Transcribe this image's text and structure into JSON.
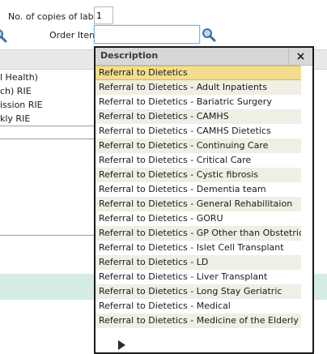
{
  "form": {
    "copies_label": "No. of copies of labels",
    "copies_value": "1",
    "order_item_label": "Order Item",
    "order_item_value": ""
  },
  "background_rows": [
    "l Health)",
    "ch) RIE",
    "ission RIE",
    "kly RIE"
  ],
  "popup": {
    "header": "Description",
    "close_label": "×",
    "items": [
      "Referral to Dietetics",
      "Referral to Dietetics - Adult Inpatients",
      "Referral to Dietetics - Bariatric Surgery",
      "Referral to Dietetics - CAMHS",
      "Referral to Dietetics - CAMHS Dietetics",
      "Referral to Dietetics - Continuing Care",
      "Referral to Dietetics - Critical Care",
      "Referral to Dietetics - Cystic fibrosis",
      "Referral to Dietetics - Dementia team",
      "Referral to Dietetics - General Rehabilitaion",
      "Referral to Dietetics - GORU",
      "Referral to Dietetics - GP Other than Obstetrics",
      "Referral to Dietetics - Islet Cell Transplant",
      "Referral to Dietetics - LD",
      "Referral to Dietetics - Liver Transplant",
      "Referral to Dietetics - Long Stay Geriatric",
      "Referral to Dietetics - Medical",
      "Referral to Dietetics - Medicine of the Elderly"
    ],
    "selected_index": 0
  },
  "icons": {
    "search": "magnifier-icon",
    "next_page": "play-arrow-icon",
    "close": "close-icon"
  },
  "colors": {
    "selected_row": "#f4dd8f",
    "alt_row": "#efefe6",
    "teal_band": "#d4ece3",
    "focus_border": "#7fb6e0"
  }
}
